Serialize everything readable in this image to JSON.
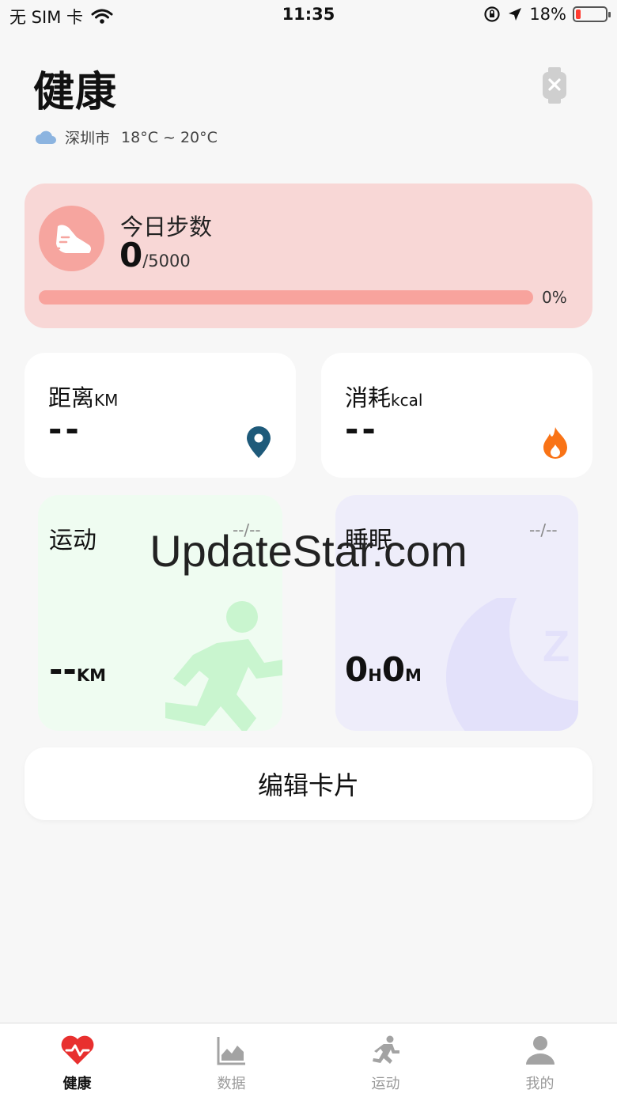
{
  "status_bar": {
    "carrier": "无 SIM 卡",
    "time": "11:35",
    "battery": "18%",
    "battery_level": 0.18
  },
  "header": {
    "title": "健康",
    "city": "深圳市",
    "temperature": "18°C ~ 20°C"
  },
  "steps": {
    "label": "今日步数",
    "value": "0",
    "goal": "/5000",
    "percent_text": "0%",
    "percent": 0
  },
  "distance": {
    "label": "距离",
    "unit": "KM",
    "value": "--"
  },
  "calories": {
    "label": "消耗",
    "unit": "kcal",
    "value": "--"
  },
  "sport": {
    "label": "运动",
    "date": "--/--",
    "value": "--",
    "unit": "KM"
  },
  "sleep": {
    "label": "睡眠",
    "date": "--/--",
    "hours": "0",
    "hours_unit": "H",
    "minutes": "0",
    "minutes_unit": "M"
  },
  "watermark": "UpdateStar.com",
  "edit_button": "编辑卡片",
  "tabs": [
    {
      "label": "健康",
      "icon": "heart-icon",
      "active": true
    },
    {
      "label": "数据",
      "icon": "chart-icon",
      "active": false
    },
    {
      "label": "运动",
      "icon": "running-icon",
      "active": false
    },
    {
      "label": "我的",
      "icon": "user-icon",
      "active": false
    }
  ],
  "colors": {
    "steps_card": "#f8d7d6",
    "accent": "#ef6b61",
    "location_pin": "#1e5a7a",
    "flame": "#f97316",
    "sport_card": "#effcf1",
    "sleep_card": "#eeedfa"
  }
}
